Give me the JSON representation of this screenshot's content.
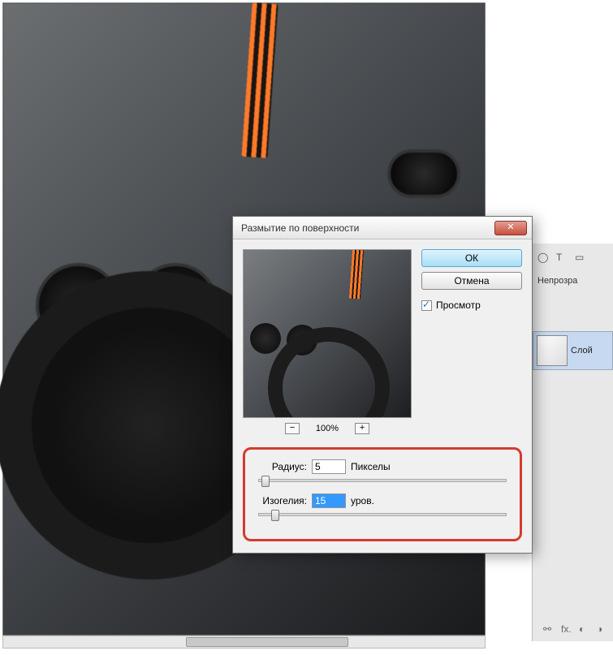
{
  "dialog": {
    "title": "Размытие по поверхности",
    "ok_label": "ОК",
    "cancel_label": "Отмена",
    "preview_label": "Просмотр",
    "preview_checked": true
  },
  "zoom": {
    "minus": "−",
    "percent": "100%",
    "plus": "+"
  },
  "params": {
    "radius": {
      "label": "Радиус:",
      "value": "5",
      "unit": "Пикселы",
      "slider_pos_pct": 1
    },
    "threshold": {
      "label": "Изогелия:",
      "value": "15",
      "unit": "уров.",
      "slider_pos_pct": 5
    }
  },
  "right_panel": {
    "opacity_label": "Непрозра",
    "layer_label": "Слой"
  },
  "bottom_icons": {
    "link": "⬤",
    "fx": "fx.",
    "mask": "◐",
    "fill": "◑"
  }
}
